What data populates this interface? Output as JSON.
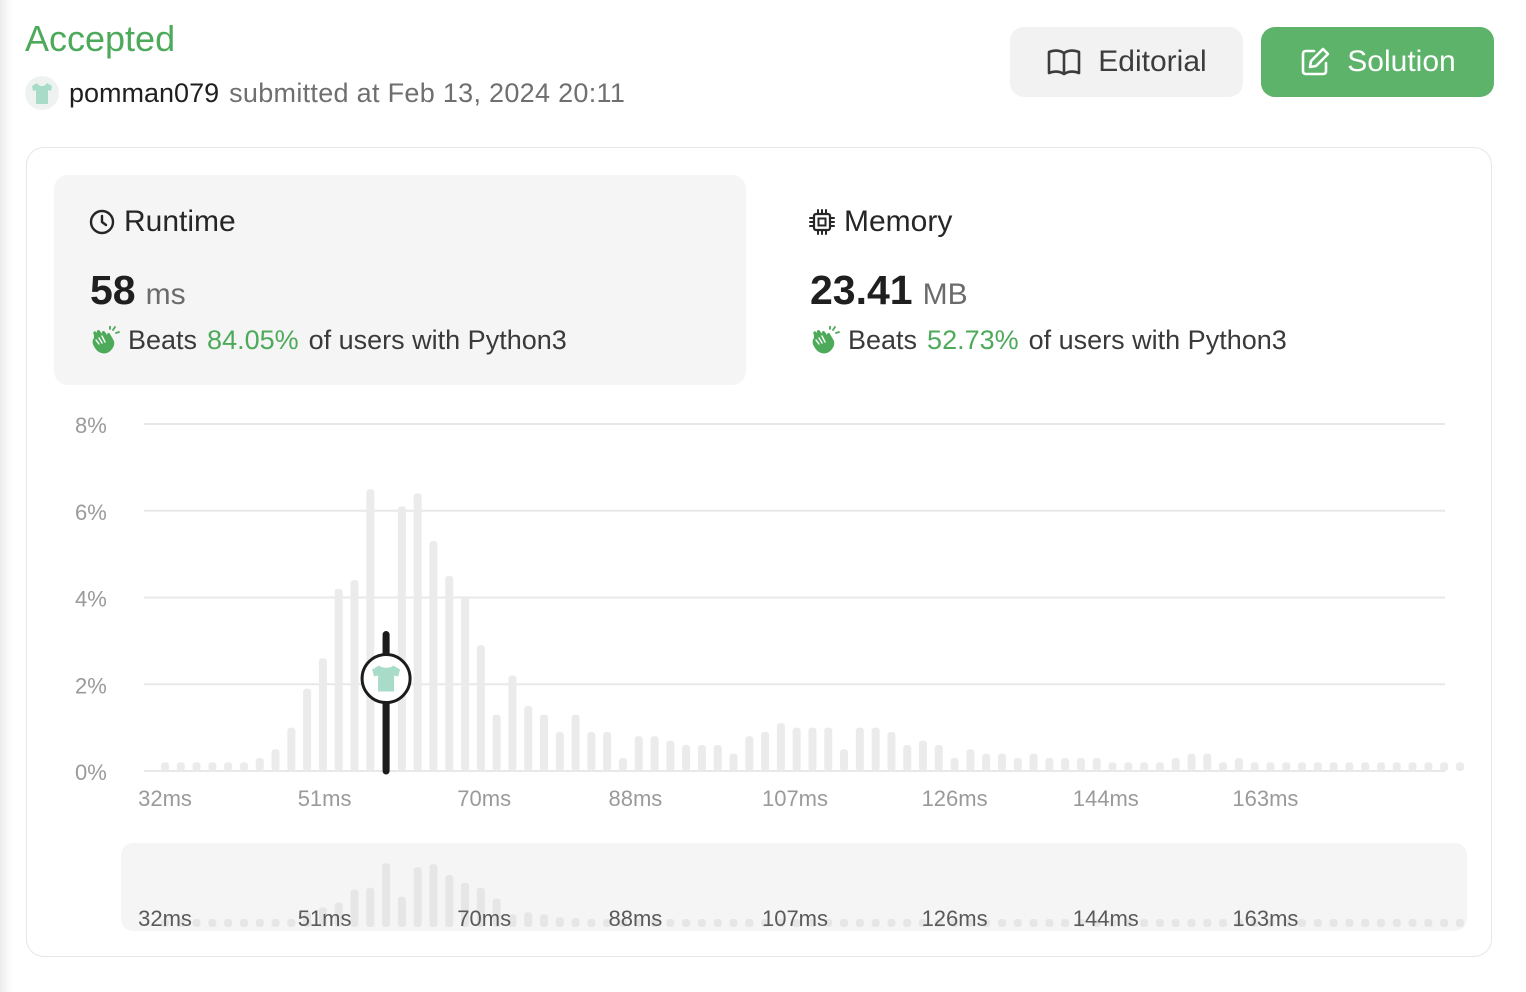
{
  "header": {
    "status": "Accepted",
    "username": "pomman079",
    "submitted_text": "submitted at Feb 13, 2024 20:11"
  },
  "buttons": {
    "editorial": "Editorial",
    "solution": "Solution"
  },
  "runtime": {
    "title": "Runtime",
    "value": "58",
    "unit": "ms",
    "beats_label": "Beats",
    "beats_pct": "84.05%",
    "beats_suffix": "of users with Python3"
  },
  "memory": {
    "title": "Memory",
    "value": "23.41",
    "unit": "MB",
    "beats_label": "Beats",
    "beats_pct": "52.73%",
    "beats_suffix": "of users with Python3"
  },
  "icons": {
    "editorial": "book-icon",
    "solution": "edit-icon",
    "runtime": "clock-icon",
    "memory": "chip-icon",
    "beats": "clap-icon",
    "avatar": "shirt-icon"
  },
  "colors": {
    "accent_green": "#4eaa5b",
    "solution_button": "#5cb369",
    "bar": "#ebebeb",
    "marker": "#1c1c1c",
    "avatar_shirt": "#a8dcc9"
  },
  "chart_data": {
    "type": "bar",
    "title": "",
    "xlabel": "",
    "ylabel": "",
    "unit": "%",
    "ylim": [
      0,
      8
    ],
    "yticks": [
      "0%",
      "2%",
      "4%",
      "6%",
      "8%"
    ],
    "xticks": [
      "32ms",
      "51ms",
      "70ms",
      "88ms",
      "107ms",
      "126ms",
      "144ms",
      "163ms"
    ],
    "xtick_values": [
      32,
      51,
      70,
      88,
      107,
      126,
      144,
      163
    ],
    "x_start": 32,
    "x_step": 1.88,
    "values": [
      0.2,
      0.2,
      0.2,
      0.2,
      0.2,
      0.2,
      0.3,
      0.5,
      1.0,
      1.9,
      2.6,
      4.2,
      4.4,
      6.5,
      3.1,
      6.1,
      6.4,
      5.3,
      4.5,
      4.0,
      2.9,
      1.3,
      2.2,
      1.5,
      1.3,
      0.9,
      1.3,
      0.9,
      0.9,
      0.3,
      0.8,
      0.8,
      0.7,
      0.6,
      0.6,
      0.6,
      0.4,
      0.8,
      0.9,
      1.1,
      1.0,
      1.0,
      1.0,
      0.5,
      1.0,
      1.0,
      0.9,
      0.6,
      0.7,
      0.6,
      0.3,
      0.5,
      0.4,
      0.4,
      0.3,
      0.4,
      0.3,
      0.3,
      0.3,
      0.3,
      0.2,
      0.2,
      0.2,
      0.2,
      0.3,
      0.4,
      0.4,
      0.2,
      0.3,
      0.2,
      0.2,
      0.2,
      0.2,
      0.2,
      0.2,
      0.2,
      0.2,
      0.2,
      0.2,
      0.2,
      0.2,
      0.2,
      0.2
    ],
    "mini_values": [
      0.25,
      0.25,
      0.25,
      0.25,
      0.25,
      0.25,
      0.25,
      0.3,
      0.8,
      1.5,
      2.0,
      2.5,
      3.8,
      4.0,
      6.5,
      3.1,
      6.1,
      6.4,
      5.3,
      4.5,
      4.0,
      2.9,
      1.3,
      1.5,
      1.3,
      1.0,
      0.9,
      0.8,
      0.6,
      0.6,
      0.6,
      0.6,
      0.6,
      0.6,
      0.6,
      0.5,
      0.5,
      0.5,
      0.5,
      0.5,
      0.5,
      0.5,
      0.5,
      0.5,
      0.5,
      0.5,
      0.5,
      0.5,
      0.5,
      0.5,
      0.5,
      0.5,
      0.5,
      0.5,
      0.5,
      0.5,
      0.5,
      0.5,
      0.5,
      0.5,
      0.5,
      0.5,
      0.5,
      0.5,
      0.5,
      0.5,
      0.5,
      0.5,
      0.5,
      0.5,
      0.5,
      0.5,
      0.5,
      0.5,
      0.5,
      0.5,
      0.5,
      0.5,
      0.5,
      0.5,
      0.5,
      0.5,
      0.5
    ],
    "highlight_index": 14,
    "highlight_label": "58ms",
    "grid": true
  }
}
